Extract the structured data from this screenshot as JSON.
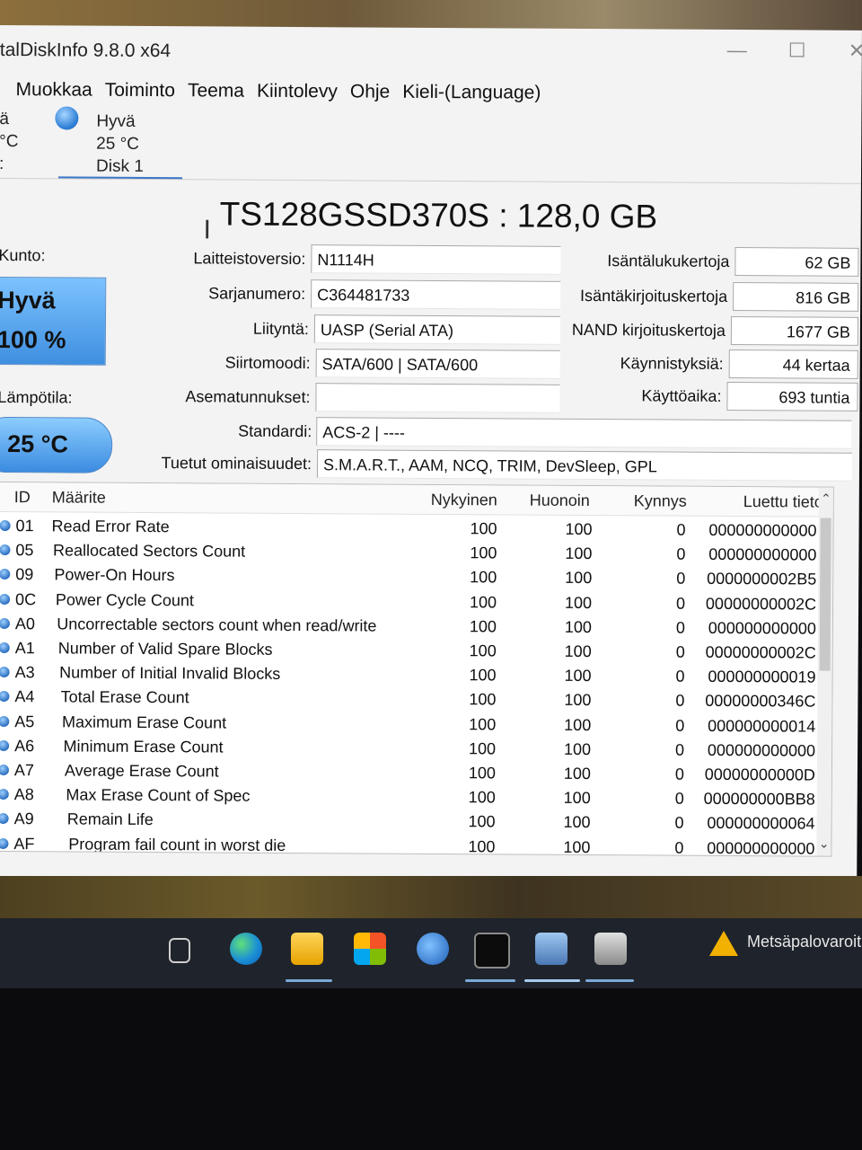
{
  "window": {
    "title": "talDiskInfo 9.8.0 x64"
  },
  "menu": [
    "Muokkaa",
    "Toiminto",
    "Teema",
    "Kiintolevy",
    "Ohje",
    "Kieli-(Language)"
  ],
  "disk_tab": {
    "left_partial": [
      "ä",
      "°C",
      ":"
    ],
    "status": "Hyvä",
    "temp": "25 °C",
    "name": "Disk 1"
  },
  "model": "TS128GSSD370S : 128,0 GB",
  "health": {
    "label": "Kunto:",
    "status": "Hyvä",
    "percent": "100 %"
  },
  "temperature": {
    "label": "Lämpötila:",
    "value": "25 °C"
  },
  "info": {
    "firmware_label": "Laitteistoversio:",
    "firmware": "N1114H",
    "serial_label": "Sarjanumero:",
    "serial": "C364481733",
    "interface_label": "Liityntä:",
    "interface": "UASP (Serial ATA)",
    "transfer_label": "Siirtomoodi:",
    "transfer": "SATA/600 | SATA/600",
    "drive_letter_label": "Asematunnukset:",
    "drive_letter": "",
    "standard_label": "Standardi:",
    "standard": "ACS-2 | ----",
    "features_label": "Tuetut ominaisuudet:",
    "features": "S.M.A.R.T., AAM, NCQ, TRIM, DevSleep, GPL"
  },
  "stats": {
    "host_reads_label": "Isäntälukukertoja",
    "host_reads": "62 GB",
    "host_writes_label": "Isäntäkirjoituskertoja",
    "host_writes": "816 GB",
    "nand_writes_label": "NAND kirjoituskertoja",
    "nand_writes": "1677 GB",
    "power_on_count_label": "Käynnistyksiä:",
    "power_on_count": "44 kertaa",
    "power_on_hours_label": "Käyttöaika:",
    "power_on_hours": "693 tuntia"
  },
  "smart": {
    "headers": [
      "ID",
      "Määrite",
      "Nykyinen",
      "Huonoin",
      "Kynnys",
      "Luettu tieto"
    ],
    "rows": [
      {
        "id": "01",
        "name": "Read Error Rate",
        "current": "100",
        "worst": "100",
        "threshold": "0",
        "raw": "000000000000"
      },
      {
        "id": "05",
        "name": "Reallocated Sectors Count",
        "current": "100",
        "worst": "100",
        "threshold": "0",
        "raw": "000000000000"
      },
      {
        "id": "09",
        "name": "Power-On Hours",
        "current": "100",
        "worst": "100",
        "threshold": "0",
        "raw": "0000000002B5"
      },
      {
        "id": "0C",
        "name": "Power Cycle Count",
        "current": "100",
        "worst": "100",
        "threshold": "0",
        "raw": "00000000002C"
      },
      {
        "id": "A0",
        "name": "Uncorrectable sectors count when read/write",
        "current": "100",
        "worst": "100",
        "threshold": "0",
        "raw": "000000000000"
      },
      {
        "id": "A1",
        "name": "Number of Valid Spare Blocks",
        "current": "100",
        "worst": "100",
        "threshold": "0",
        "raw": "00000000002C"
      },
      {
        "id": "A3",
        "name": "Number of Initial Invalid Blocks",
        "current": "100",
        "worst": "100",
        "threshold": "0",
        "raw": "000000000019"
      },
      {
        "id": "A4",
        "name": "Total Erase Count",
        "current": "100",
        "worst": "100",
        "threshold": "0",
        "raw": "00000000346C"
      },
      {
        "id": "A5",
        "name": "Maximum Erase Count",
        "current": "100",
        "worst": "100",
        "threshold": "0",
        "raw": "000000000014"
      },
      {
        "id": "A6",
        "name": "Minimum Erase Count",
        "current": "100",
        "worst": "100",
        "threshold": "0",
        "raw": "000000000000"
      },
      {
        "id": "A7",
        "name": "Average Erase Count",
        "current": "100",
        "worst": "100",
        "threshold": "0",
        "raw": "00000000000D"
      },
      {
        "id": "A8",
        "name": "Max Erase Count of Spec",
        "current": "100",
        "worst": "100",
        "threshold": "0",
        "raw": "000000000BB8"
      },
      {
        "id": "A9",
        "name": "Remain Life",
        "current": "100",
        "worst": "100",
        "threshold": "0",
        "raw": "000000000064"
      },
      {
        "id": "AF",
        "name": "Program fail count in worst die",
        "current": "100",
        "worst": "100",
        "threshold": "0",
        "raw": "000000000000"
      }
    ]
  },
  "taskbar": {
    "notification": "Metsäpalovaroit"
  },
  "colors": {
    "good_blue": "#3f8fe0",
    "taskbar": "#1f232b"
  }
}
